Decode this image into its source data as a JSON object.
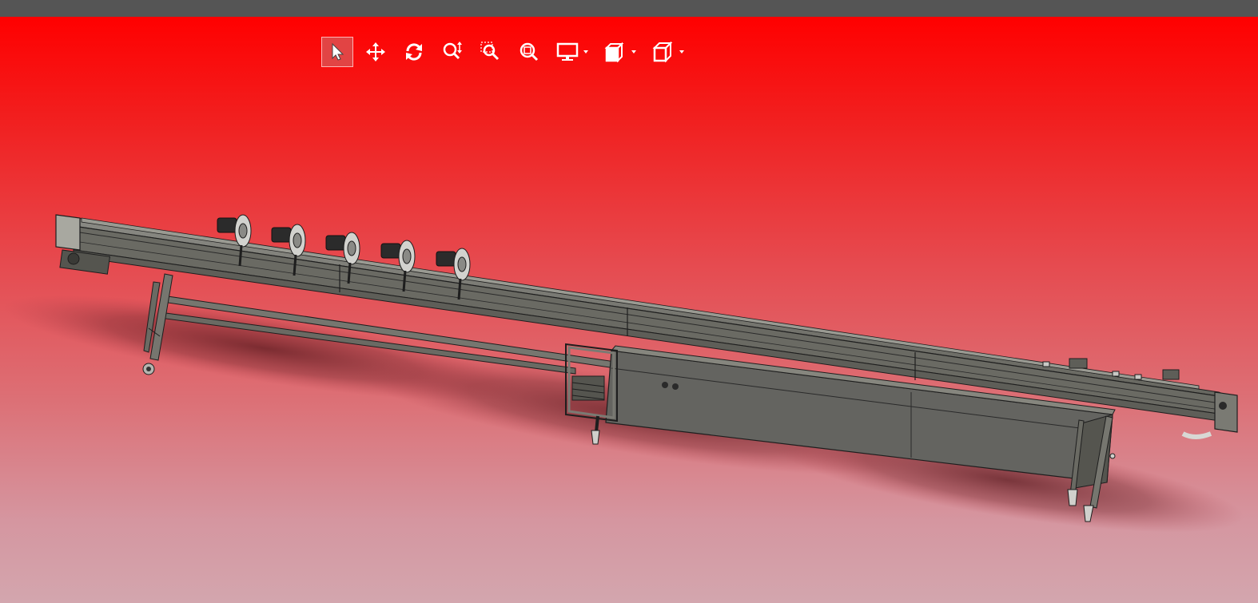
{
  "window": {
    "titlebar_color": "#555555"
  },
  "viewport": {
    "background_top": "#ff0000",
    "background_bottom": "#d3a6ae"
  },
  "toolbar": {
    "tools": [
      {
        "name": "select",
        "icon": "cursor-arrow-icon",
        "active": true
      },
      {
        "name": "pan",
        "icon": "move-arrows-icon",
        "active": false
      },
      {
        "name": "rotate",
        "icon": "rotate-arrows-icon",
        "active": false
      },
      {
        "name": "zoom",
        "icon": "zoom-updown-icon",
        "active": false
      },
      {
        "name": "zoom-window",
        "icon": "zoom-window-icon",
        "active": false
      },
      {
        "name": "zoom-fit",
        "icon": "zoom-fit-icon",
        "active": false
      },
      {
        "name": "display-mode",
        "icon": "monitor-icon",
        "dropdown": true
      },
      {
        "name": "view-orientation",
        "icon": "standard-views-icon",
        "dropdown": true
      },
      {
        "name": "display-style",
        "icon": "cube-icon",
        "dropdown": true
      }
    ]
  },
  "model": {
    "metal_color": "#6e6e68",
    "edge_color": "#1e1e1e"
  }
}
